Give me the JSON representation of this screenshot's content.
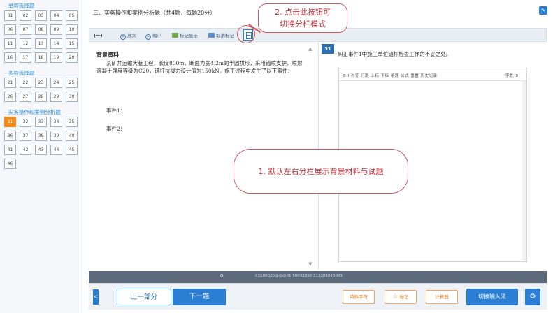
{
  "sidebar": {
    "sections": [
      {
        "title": "单项选择题",
        "items": [
          "01",
          "02",
          "03",
          "04",
          "05",
          "06",
          "07",
          "08",
          "09",
          "10",
          "11",
          "12",
          "13",
          "14",
          "15",
          "16",
          "17",
          "18",
          "19",
          "20"
        ]
      },
      {
        "title": "多项选择题",
        "items": [
          "21",
          "22",
          "23",
          "24",
          "25",
          "26",
          "27",
          "28",
          "29",
          "30"
        ]
      },
      {
        "title": "实务操作和案例分析题",
        "items": [
          "31",
          "32",
          "33",
          "34",
          "35",
          "36",
          "37",
          "38",
          "39",
          "40",
          "41",
          "42",
          "43",
          "44",
          "45",
          "46"
        ]
      }
    ],
    "active_item": "31"
  },
  "header": {
    "section_title": "三、实务操作和案例分析题（共4题，每题20分）",
    "top_right_icon": "note-icon"
  },
  "callouts": {
    "callout_2_line1": "2. 点击此按钮可",
    "callout_2_line2": "切换分栏模式",
    "callout_1": "1. 默认左右分栏展示背景材料与试题"
  },
  "toolbar": {
    "label": "(一)",
    "zoom_in": "放大",
    "zoom_out": "缩小",
    "highlight": "标记显示",
    "clear_highlight": "取消标记"
  },
  "left_pane": {
    "bg_title": "背景资料",
    "bg_text": "某矿井运输大巷工程，长度800m，断面为宽4.2m的半圆拱形，采用锚喷支护，喷射混凝土强度等级为C20，锚杆抗拔力设计值为150kN。施工过程中发生了以下事件：",
    "event_1": "事件1：",
    "event_2": "事件2："
  },
  "right_pane": {
    "question_number": "31",
    "question_text": "纠正事件1中施工单位锚杆检查工作的不妥之处。",
    "editor_tools": "B   I   对齐  行距  上标  下标  格器  公式  重置  历史记录",
    "word_count": "字数: 0"
  },
  "statusbar": {
    "number": "0",
    "code": "03100020@@@01 50032892 313201010001"
  },
  "bottombar": {
    "collapse": "<",
    "prev": "上一部分",
    "next": "下一题",
    "special_chars": "特殊字符",
    "mark": "标记",
    "calculator": "计算器",
    "switch_input": "切换输入法",
    "settings_icon": "gear-icon"
  },
  "colors": {
    "accent": "#2a7fd4",
    "active": "#f08a1c",
    "callout": "#c95a60"
  }
}
